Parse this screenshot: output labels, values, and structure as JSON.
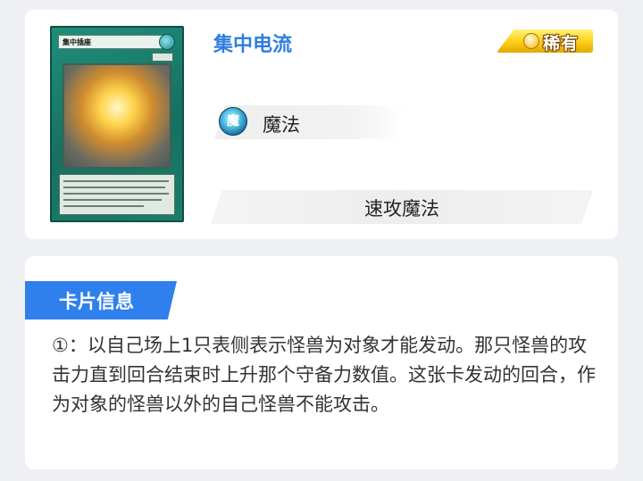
{
  "card": {
    "name": "集中电流",
    "rarity_label": "稀有",
    "attribute_icon_glyph": "魔",
    "attribute_label": "魔法",
    "type_label": "速攻魔法",
    "image_name_bar": "集中插座",
    "colors": {
      "title": "#2f7ee0",
      "card_frame": "#1f8e7b",
      "rarity_gold": "#ffd21a"
    }
  },
  "info": {
    "section_label": "卡片信息",
    "effect_text": "①：以自己场上1只表侧表示怪兽为对象才能发动。那只怪兽的攻击力直到回合结束时上升那个守备力数值。这张卡发动的回合，作为对象的怪兽以外的自己怪兽不能攻击。",
    "accent_color": "#2f80ed"
  }
}
